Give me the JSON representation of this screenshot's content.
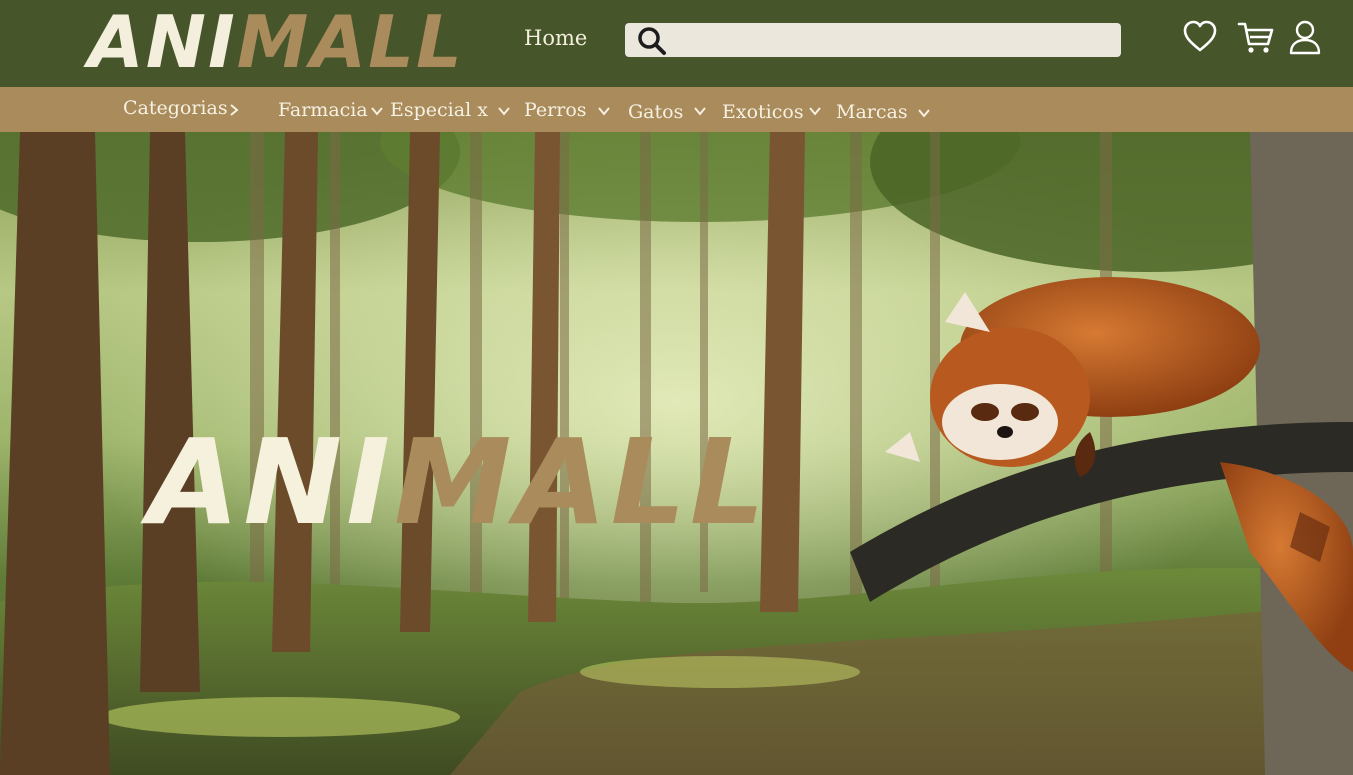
{
  "brand": {
    "logo_part1": "ANI",
    "logo_part2": "MALL"
  },
  "header": {
    "home_label": "Home",
    "search_placeholder": ""
  },
  "icons": {
    "favorites": "heart-icon",
    "cart": "cart-icon",
    "account": "user-icon",
    "search": "search-icon"
  },
  "categories": [
    {
      "label": "Categorias"
    },
    {
      "label": "Farmacia"
    },
    {
      "label": "Especial x"
    },
    {
      "label": "Perros"
    },
    {
      "label": "Gatos"
    },
    {
      "label": "Exoticos"
    },
    {
      "label": "Marcas"
    }
  ],
  "hero": {
    "title_part1": "ANI",
    "title_part2": "MALL"
  },
  "colors": {
    "header_bg": "#46552a",
    "nav_bg": "#a98b5c",
    "cream": "#f3efdc",
    "tan": "#a98b5c"
  }
}
